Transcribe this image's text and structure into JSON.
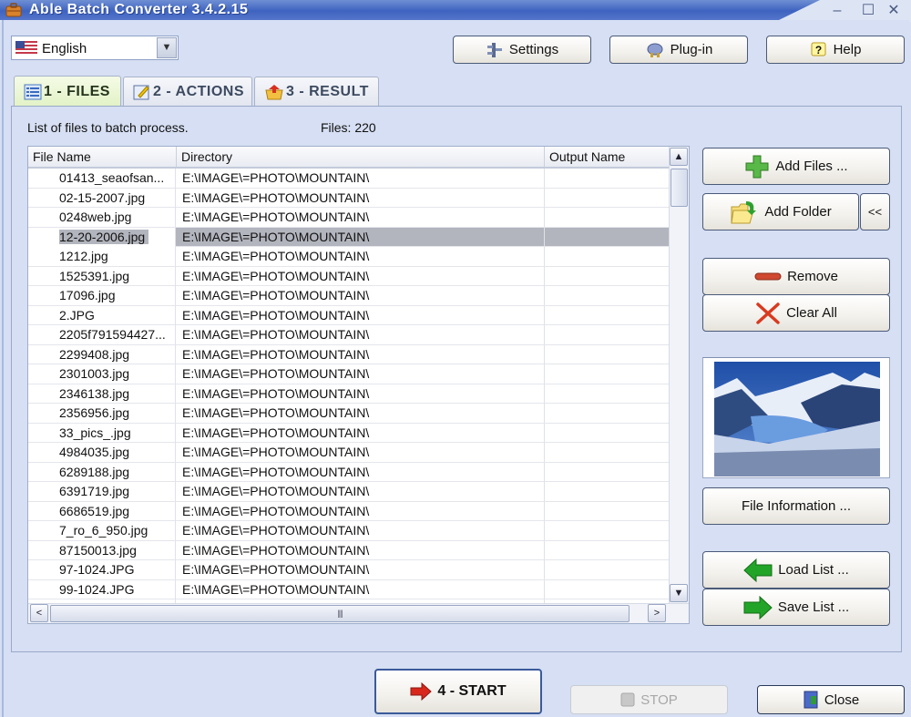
{
  "window": {
    "title": "Able Batch Converter 3.4.2.15",
    "controls": {
      "minimize": "–",
      "maximize": "☐",
      "close": "✕"
    }
  },
  "language": {
    "selected": "English",
    "icon": "us-flag-icon"
  },
  "toolbar": {
    "settings_label": "Settings",
    "plugin_label": "Plug-in",
    "help_label": "Help"
  },
  "tabs": [
    {
      "label": "1 - FILES",
      "active": true,
      "icon": "list-icon"
    },
    {
      "label": "2 - ACTIONS",
      "active": false,
      "icon": "edit-icon"
    },
    {
      "label": "3 - RESULT",
      "active": false,
      "icon": "result-icon"
    }
  ],
  "files_panel": {
    "caption": "List of files to batch process.",
    "count_text": "Files: 220",
    "columns": [
      "File Name",
      "Directory",
      "Output Name"
    ],
    "rows": [
      {
        "name": "01413_seaofsan...",
        "dir": "E:\\IMAGE\\=PHOTO\\MOUNTAIN\\",
        "output": ""
      },
      {
        "name": "02-15-2007.jpg",
        "dir": "E:\\IMAGE\\=PHOTO\\MOUNTAIN\\",
        "output": ""
      },
      {
        "name": "0248web.jpg",
        "dir": "E:\\IMAGE\\=PHOTO\\MOUNTAIN\\",
        "output": ""
      },
      {
        "name": "12-20-2006.jpg",
        "dir": "E:\\IMAGE\\=PHOTO\\MOUNTAIN\\",
        "output": "",
        "selected": true
      },
      {
        "name": "1212.jpg",
        "dir": "E:\\IMAGE\\=PHOTO\\MOUNTAIN\\",
        "output": ""
      },
      {
        "name": "1525391.jpg",
        "dir": "E:\\IMAGE\\=PHOTO\\MOUNTAIN\\",
        "output": ""
      },
      {
        "name": "17096.jpg",
        "dir": "E:\\IMAGE\\=PHOTO\\MOUNTAIN\\",
        "output": ""
      },
      {
        "name": "2.JPG",
        "dir": "E:\\IMAGE\\=PHOTO\\MOUNTAIN\\",
        "output": ""
      },
      {
        "name": "2205f791594427...",
        "dir": "E:\\IMAGE\\=PHOTO\\MOUNTAIN\\",
        "output": ""
      },
      {
        "name": "2299408.jpg",
        "dir": "E:\\IMAGE\\=PHOTO\\MOUNTAIN\\",
        "output": ""
      },
      {
        "name": "2301003.jpg",
        "dir": "E:\\IMAGE\\=PHOTO\\MOUNTAIN\\",
        "output": ""
      },
      {
        "name": "2346138.jpg",
        "dir": "E:\\IMAGE\\=PHOTO\\MOUNTAIN\\",
        "output": ""
      },
      {
        "name": "2356956.jpg",
        "dir": "E:\\IMAGE\\=PHOTO\\MOUNTAIN\\",
        "output": ""
      },
      {
        "name": "33_pics_.jpg",
        "dir": "E:\\IMAGE\\=PHOTO\\MOUNTAIN\\",
        "output": ""
      },
      {
        "name": "4984035.jpg",
        "dir": "E:\\IMAGE\\=PHOTO\\MOUNTAIN\\",
        "output": ""
      },
      {
        "name": "6289188.jpg",
        "dir": "E:\\IMAGE\\=PHOTO\\MOUNTAIN\\",
        "output": ""
      },
      {
        "name": "6391719.jpg",
        "dir": "E:\\IMAGE\\=PHOTO\\MOUNTAIN\\",
        "output": ""
      },
      {
        "name": "6686519.jpg",
        "dir": "E:\\IMAGE\\=PHOTO\\MOUNTAIN\\",
        "output": ""
      },
      {
        "name": "7_ro_6_950.jpg",
        "dir": "E:\\IMAGE\\=PHOTO\\MOUNTAIN\\",
        "output": ""
      },
      {
        "name": "87150013.jpg",
        "dir": "E:\\IMAGE\\=PHOTO\\MOUNTAIN\\",
        "output": ""
      },
      {
        "name": "97-1024.JPG",
        "dir": "E:\\IMAGE\\=PHOTO\\MOUNTAIN\\",
        "output": ""
      },
      {
        "name": "99-1024.JPG",
        "dir": "E:\\IMAGE\\=PHOTO\\MOUNTAIN\\",
        "output": ""
      },
      {
        "name": "",
        "dir": "",
        "output": ""
      }
    ],
    "vscroll": {
      "up": "⌃",
      "down": "⌄",
      "grip": "≡"
    },
    "hscroll": {
      "left": "<",
      "right": ">",
      "grip": "||||"
    }
  },
  "side_buttons": {
    "add_files": "Add Files ...",
    "add_folder": "Add Folder",
    "collapse": "<<",
    "remove": "Remove",
    "clear_all": "Clear All",
    "file_information": "File Information ...",
    "load_list": "Load List ...",
    "save_list": "Save List ..."
  },
  "preview": {
    "alt": "snowy mountain lake preview"
  },
  "footer": {
    "start_label": "4 - START",
    "stop_label": "STOP",
    "close_label": "Close"
  },
  "colors": {
    "titlebar": "#3e63c0",
    "window_bg": "#d6dff3",
    "active_tab": "#e2f2c6",
    "selected_row": "#b3b5be"
  }
}
